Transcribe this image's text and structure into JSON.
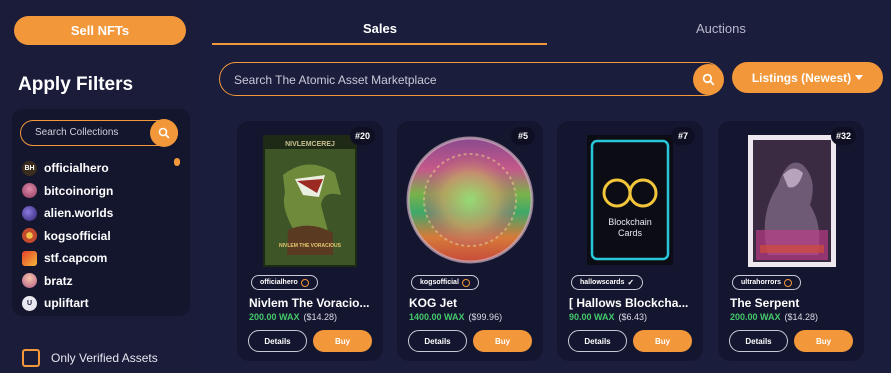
{
  "sidebar": {
    "sell_label": "Sell NFTs",
    "filters_title": "Apply Filters",
    "collection_search_placeholder": "Search Collections",
    "collections": [
      {
        "name": "officialhero",
        "avatar_text": "BH",
        "color": "#3a2d1e"
      },
      {
        "name": "bitcoinorign",
        "avatar_text": "",
        "color": "#b5517a"
      },
      {
        "name": "alien.worlds",
        "avatar_text": "",
        "color": "#4b3b9a"
      },
      {
        "name": "kogsofficial",
        "avatar_text": "",
        "color": "#c44a2d"
      },
      {
        "name": "stf.capcom",
        "avatar_text": "",
        "color": "#d23b2a"
      },
      {
        "name": "bratz",
        "avatar_text": "",
        "color": "#d67ab0"
      },
      {
        "name": "upliftart",
        "avatar_text": "U",
        "color": "#e8e8f0"
      }
    ],
    "verified_label": "Only Verified Assets"
  },
  "tabs": [
    {
      "label": "Sales",
      "active": true
    },
    {
      "label": "Auctions",
      "active": false
    }
  ],
  "search": {
    "placeholder": "Search The Atomic Asset Marketplace"
  },
  "sort": {
    "label": "Listings (Newest)"
  },
  "cards": [
    {
      "num": "#20",
      "collection": "officialhero",
      "verified": true,
      "name": "Nivlem The Voracio...",
      "wax": "200.00 WAX",
      "usd": "($14.28)",
      "details": "Details",
      "buy": "Buy"
    },
    {
      "num": "#5",
      "collection": "kogsofficial",
      "verified": true,
      "name": "KOG Jet",
      "wax": "1400.00 WAX",
      "usd": "($99.96)",
      "details": "Details",
      "buy": "Buy"
    },
    {
      "num": "#7",
      "collection": "hallowscards",
      "verified": true,
      "name": "[ Hallows Blockcha...",
      "wax": "90.00 WAX",
      "usd": "($6.43)",
      "details": "Details",
      "buy": "Buy"
    },
    {
      "num": "#32",
      "collection": "ultrahorrors",
      "verified": true,
      "name": "The Serpent",
      "wax": "200.00 WAX",
      "usd": "($14.28)",
      "details": "Details",
      "buy": "Buy"
    }
  ],
  "card_art_text": {
    "c1_top": "NIVLEMCEREJ",
    "c1_bottom": "NIVLEM THE VORACIOUS",
    "c3_line1": "Blockchain",
    "c3_line2": "Cards"
  },
  "colors": {
    "accent": "#f2973a",
    "price_green": "#44c86a",
    "bg": "#1b1d3c",
    "card_bg": "#141630"
  }
}
